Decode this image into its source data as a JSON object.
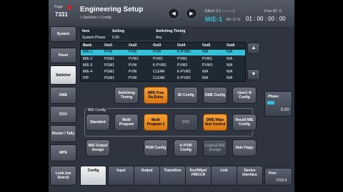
{
  "header": {
    "page_label": "Page",
    "page_number": "7331",
    "title": "Engineering Setup",
    "breadcrumb": "> Switcher > Config",
    "effect_label": "Effect: 0 (-----------)",
    "me_label": "M/E-1",
    "kf_label": "KF: 0 / 0",
    "free_kf": "Free KF: 0",
    "timecode": "01 : 00 : 00 : 00"
  },
  "sidebar": [
    {
      "label": "System"
    },
    {
      "label": "Panel"
    },
    {
      "label": "Switcher"
    },
    {
      "label": "DME"
    },
    {
      "label": "DCU"
    },
    {
      "label": "Router / Tally"
    },
    {
      "label": "MPE"
    },
    {
      "label": "Look (sw Select)"
    }
  ],
  "item_table": {
    "item_header": "Item",
    "setting_header": "Setting",
    "item_value": "System Phase",
    "setting_value": "0.00",
    "timing_header": "Switching Timing",
    "timing_value": "Any"
  },
  "bank_table": {
    "headers": [
      "Bank",
      "Out1",
      "Out2",
      "Out3",
      "Out4",
      "Out5",
      "Out6"
    ],
    "rows": [
      [
        "M/E-1",
        "PVW",
        "PVW",
        "PVW",
        "K-PVW1",
        "N/A",
        "N/A"
      ],
      [
        "M/E-2",
        "PGM1",
        "PVW1",
        "PVW1",
        "PVW1",
        "PVW1",
        "N/A"
      ],
      [
        "M/E-3",
        "PGM1",
        "PVW",
        "K-PVW1",
        "PVW3",
        "PVW3",
        "N/A"
      ],
      [
        "M/E-4",
        "PGM1",
        "PVW",
        "CLEAR",
        "K-PVW1",
        "N/A",
        "N/A"
      ],
      [
        "P/P",
        "PGM1",
        "PVW",
        "CLEAR",
        "K-PVW1",
        "N/A",
        "N/A"
      ]
    ]
  },
  "buttons": {
    "switching_timing": "Switching Timing",
    "mpe_free": "MPE Free Re-Entry",
    "3d_config": "3D Config",
    "dme_config": "DME Config",
    "user_config": "User1~8 Config",
    "me_config_label": "M/E Config",
    "standard": "Standard",
    "multi_program": "Multi Program",
    "multi_program2": "Multi Program 2",
    "dsk": "DSK",
    "dme_wipe": "DME Wipe Sub Control",
    "recall_me": "Recall M/E Config",
    "me_output": "M/E Output Assign",
    "pgm_config": "PGM Config",
    "kpvw_config": "K-PVW Config",
    "logical_me": "Logical M/E Assign",
    "side_flags": "Side Flags"
  },
  "phase": {
    "label": "Phase",
    "value": "0.00"
  },
  "tabs": [
    {
      "label": "Config"
    },
    {
      "label": "Input"
    },
    {
      "label": "Output"
    },
    {
      "label": "Transition"
    },
    {
      "label": "Key/Wipe/ FM/CCR"
    },
    {
      "label": "Link"
    },
    {
      "label": "Device Interface"
    }
  ],
  "prev": {
    "label": "Prev",
    "number": "7216.9"
  },
  "colors": {
    "highlight": "#36c0d8",
    "orange": "#f08a24",
    "accent_red": "#e02020"
  }
}
